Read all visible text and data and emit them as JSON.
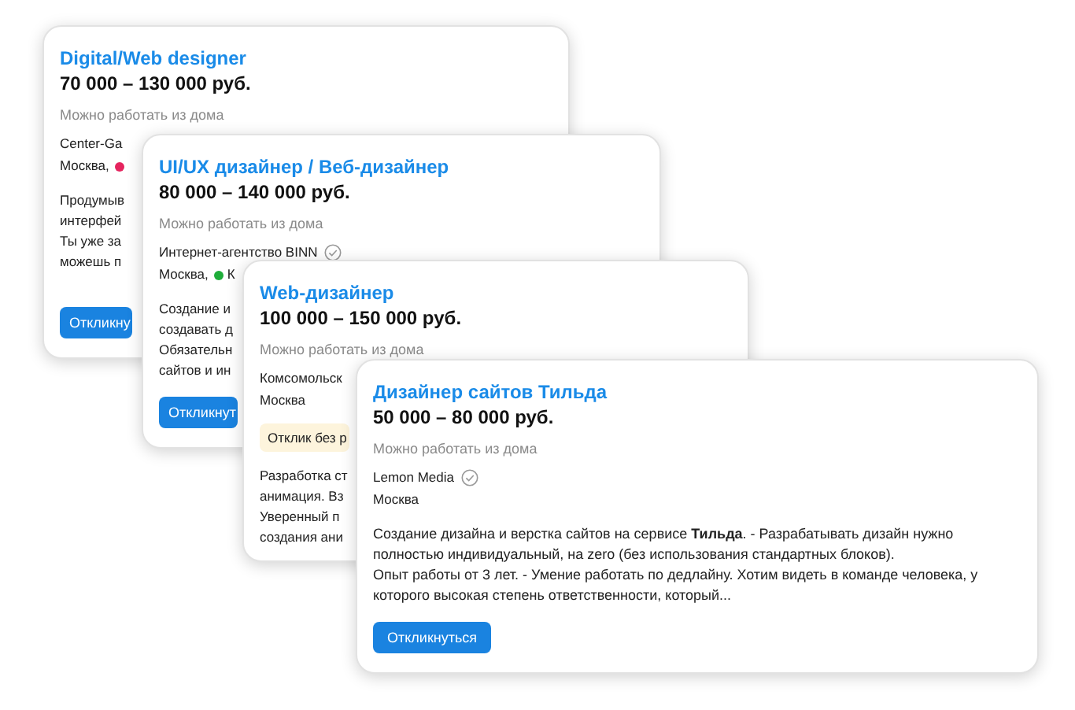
{
  "cards": [
    {
      "title": "Digital/Web designer",
      "salary": "70 000 – 130 000 руб.",
      "remote": "Можно работать из дома",
      "company": "Center-Ga",
      "city": "Москва,",
      "color": "#e5245e",
      "description": [
        "Продумыв",
        "интерфей",
        "Ты уже за",
        "можешь п"
      ],
      "button": "Откликну"
    },
    {
      "title": "UI/UX дизайнер / Веб-дизайнер",
      "salary": "80 000 – 140 000 руб.",
      "remote": "Можно работать из дома",
      "company": "Интернет-агентство BINN",
      "verified": true,
      "city": "Москва,",
      "color": "#1fad3a",
      "station": "К",
      "description": [
        "Создание и",
        "создавать д",
        "Обязательн",
        "сайтов и ин"
      ],
      "button": "Откликнут"
    },
    {
      "title": "Web-дизайнер",
      "salary": "100 000 – 150 000 руб.",
      "remote": "Можно работать из дома",
      "company": "Комсомольск",
      "city": "Москва",
      "badge": "Отклик без р",
      "description": [
        "Разработка ст",
        "анимация. Вз",
        "Уверенный п",
        "создания ани"
      ]
    },
    {
      "title": "Дизайнер сайтов Тильда",
      "salary": "50 000 – 80 000 руб.",
      "remote": "Можно работать из дома",
      "company": "Lemon Media",
      "verified": true,
      "city": "Москва",
      "description": [
        "Создание дизайна и верстка сайтов на сервисе **Тильда**. - Разрабатывать дизайн нужно полностью индивидуальный, на zero (без использования стандартных блоков).",
        "Опыт работы от 3 лет. - Умение работать по дедлайну. Хотим видеть в команде человека, у которого высокая степень ответственности, который..."
      ],
      "button": "Откликнуться"
    }
  ]
}
